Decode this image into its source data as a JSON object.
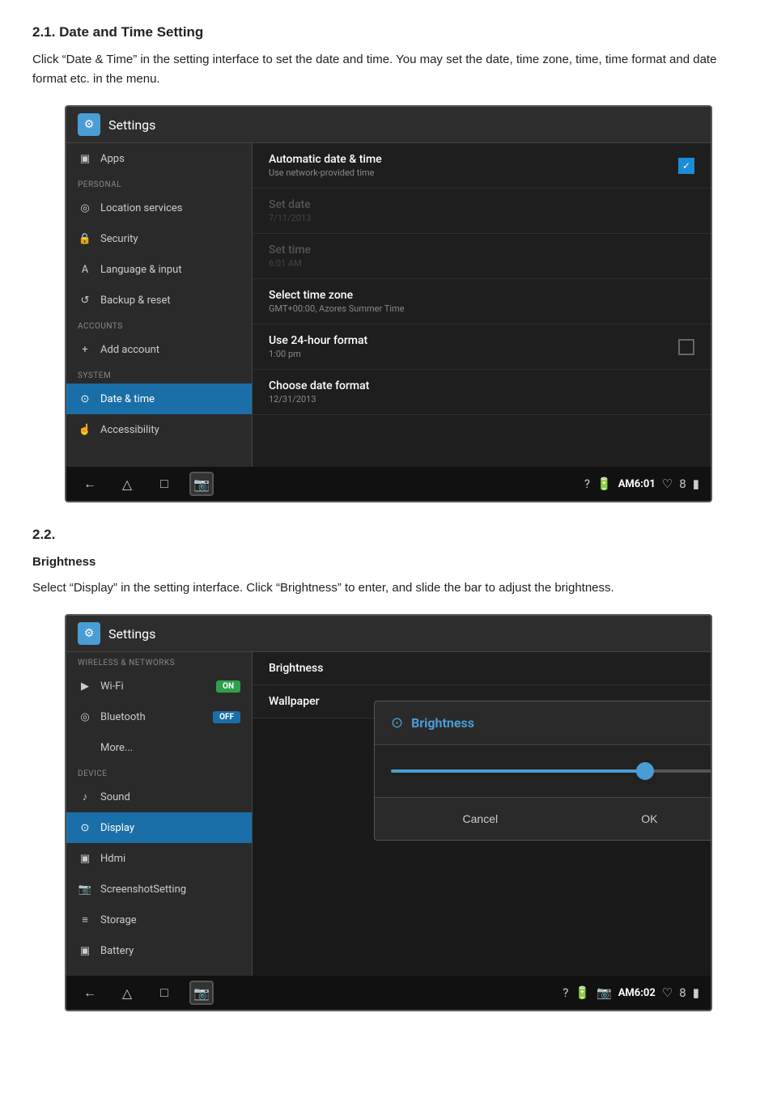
{
  "doc": {
    "section1_num": "2.1.",
    "section1_title": "Date and Time Setting",
    "section1_p1": "Click “Date & Time” in the setting interface to set the date and time. You may set the date, time zone, time, time format and date format etc. in the menu.",
    "section2_num": "2.2.",
    "section2_title": "Brightness",
    "section2_p1": "Select “Display” in the setting interface. Click “Brightness” to enter, and slide the bar to adjust the brightness."
  },
  "screen1": {
    "header_icon": "⚙",
    "header_title": "Settings",
    "sidebar": {
      "items": [
        {
          "icon": "□",
          "label": "Apps",
          "active": false
        },
        {
          "section": "PERSONAL"
        },
        {
          "icon": "◎",
          "label": "Location services",
          "active": false
        },
        {
          "icon": "🔒",
          "label": "Security",
          "active": false
        },
        {
          "icon": "A",
          "label": "Language & input",
          "active": false
        },
        {
          "icon": "↺",
          "label": "Backup & reset",
          "active": false
        },
        {
          "section": "ACCOUNTS"
        },
        {
          "icon": "+",
          "label": "Add account",
          "active": false
        },
        {
          "section": "SYSTEM"
        },
        {
          "icon": "⏰",
          "label": "Date & time",
          "active": true
        },
        {
          "icon": "☝",
          "label": "Accessibility",
          "active": false
        }
      ]
    },
    "main": {
      "rows": [
        {
          "title": "Automatic date & time",
          "sub": "Use network-provided time",
          "checked": true,
          "disabled": false
        },
        {
          "title": "Set date",
          "sub": "7/11/2013",
          "checked": false,
          "disabled": true
        },
        {
          "title": "Set time",
          "sub": "6:01 AM",
          "checked": false,
          "disabled": true
        },
        {
          "title": "Select time zone",
          "sub": "GMT+00:00, Azores Summer Time",
          "checked": false,
          "disabled": false
        },
        {
          "title": "Use 24-hour format",
          "sub": "1:00 pm",
          "checked": false,
          "disabled": false
        },
        {
          "title": "Choose date format",
          "sub": "12/31/2013",
          "checked": false,
          "disabled": false
        }
      ]
    },
    "status": {
      "time": "AM6:01",
      "battery": "8"
    }
  },
  "screen2": {
    "header_icon": "⚙",
    "header_title": "Settings",
    "sidebar": {
      "items": [
        {
          "section": "WIRELESS & NETWORKS"
        },
        {
          "icon": "▶",
          "label": "Wi-Fi",
          "badge": "ON",
          "active": false
        },
        {
          "icon": "○",
          "label": "Bluetooth",
          "badge": "OFF",
          "active": false
        },
        {
          "icon": "",
          "label": "More...",
          "active": false
        },
        {
          "section": "DEVICE"
        },
        {
          "icon": "♪",
          "label": "Sound",
          "active": false
        },
        {
          "icon": "□",
          "label": "Display",
          "active": true
        },
        {
          "icon": "□",
          "label": "Hdmi",
          "active": false
        },
        {
          "icon": "📷",
          "label": "ScreenshotSetting",
          "active": false
        },
        {
          "icon": "≡",
          "label": "Storage",
          "active": false
        },
        {
          "icon": "□",
          "label": "Battery",
          "active": false
        }
      ]
    },
    "main": {
      "rows": [
        {
          "title": "Brightness",
          "sub": ""
        },
        {
          "title": "Wallpaper",
          "sub": ""
        }
      ]
    },
    "dialog": {
      "icon": "◎",
      "title": "Brightness",
      "slider_percent": 75,
      "cancel_label": "Cancel",
      "ok_label": "OK"
    },
    "status": {
      "time": "AM6:02",
      "battery": "8"
    }
  },
  "nav": {
    "back": "←",
    "home": "□",
    "recent": "□",
    "camera": "📷"
  }
}
